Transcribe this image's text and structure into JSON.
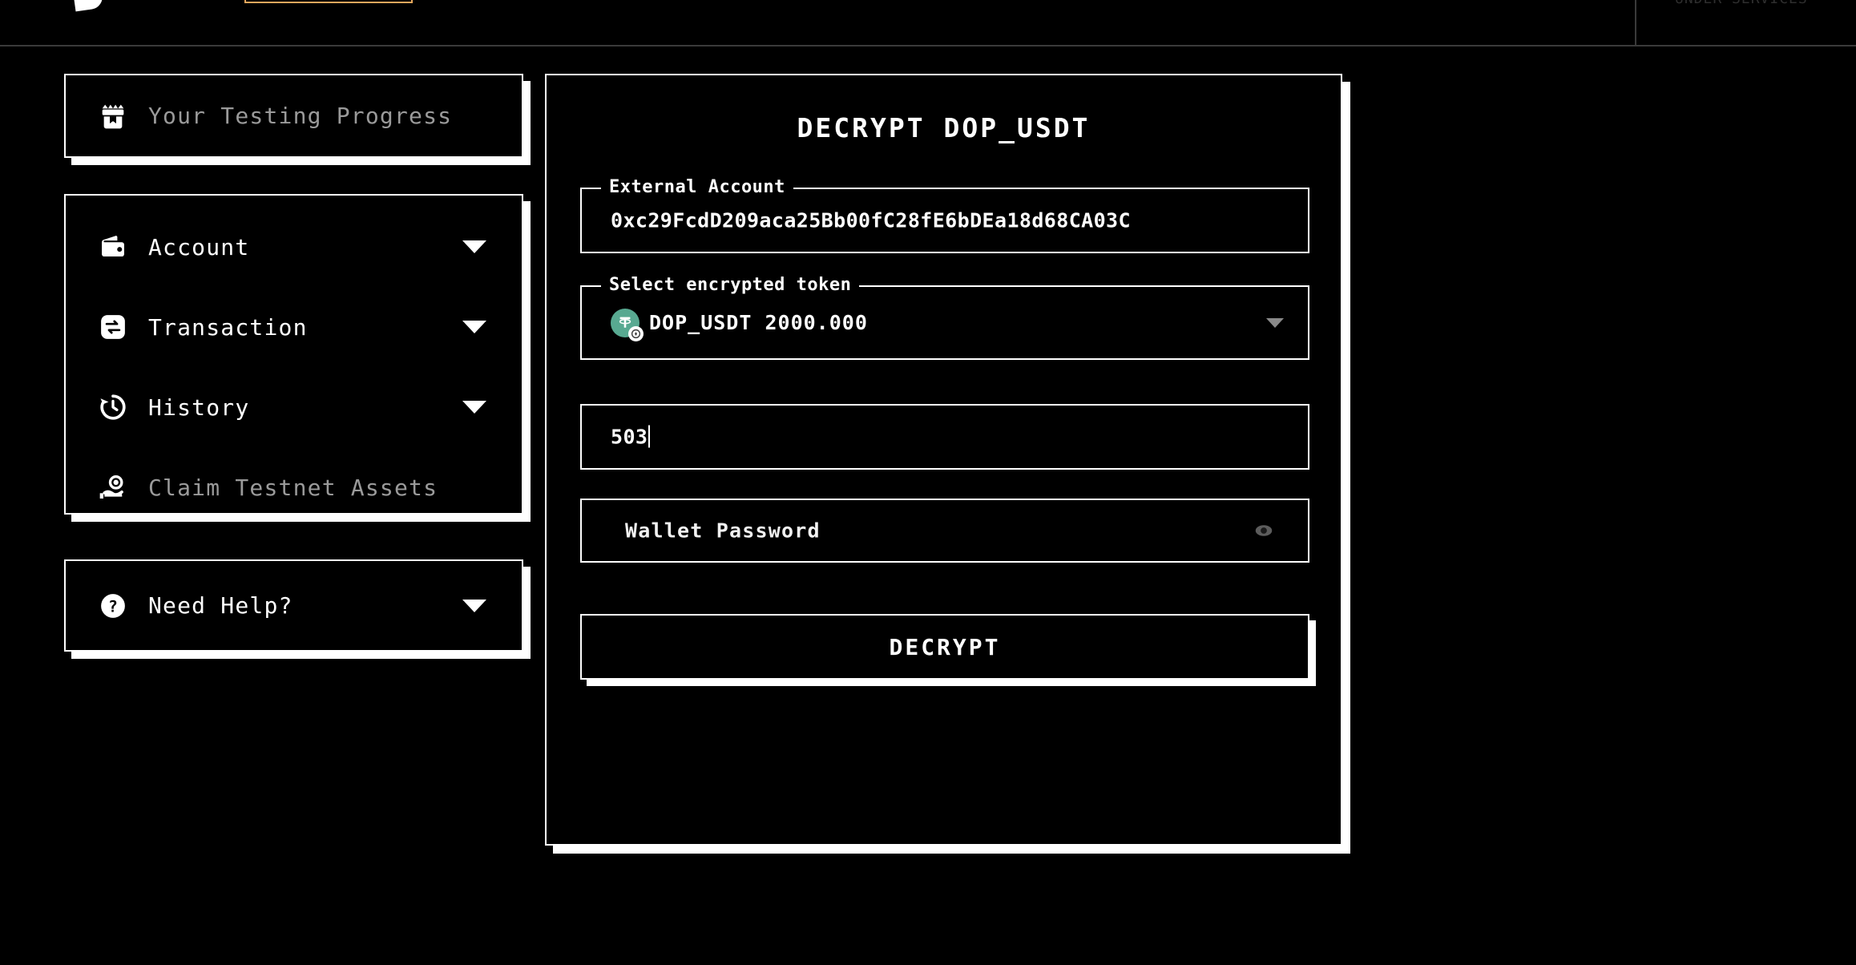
{
  "header": {
    "logo_icon": "brand-logo-icon",
    "active_tab_label": "",
    "right_text": "UNDER SERVICES",
    "accent_color": "#e8a75c"
  },
  "sidebar": {
    "progress_card": {
      "icon": "gift-box-icon",
      "label": "Your Testing Progress"
    },
    "menu_items": [
      {
        "icon": "wallet-icon",
        "label": "Account",
        "has_caret": true,
        "muted": false
      },
      {
        "icon": "swap-icon",
        "label": "Transaction",
        "has_caret": true,
        "muted": false
      },
      {
        "icon": "history-icon",
        "label": "History",
        "has_caret": true,
        "muted": false
      },
      {
        "icon": "hand-coin-icon",
        "label": "Claim Testnet Assets",
        "has_caret": false,
        "muted": true
      }
    ],
    "help_card": {
      "icon": "question-circle-icon",
      "label": "Need Help?",
      "has_caret": true
    }
  },
  "main": {
    "title": "DECRYPT DOP_USDT",
    "external_account": {
      "legend": "External Account",
      "value": "0xc29FcdD209aca25Bb00fC28fE6bDEa18d68CA03C"
    },
    "token_select": {
      "legend": "Select encrypted token",
      "token_symbol": "DOP_USDT",
      "token_amount": "2000.000",
      "display": "DOP_USDT 2000.000",
      "logo_color": "#58a991",
      "logo_glyph": "T",
      "caret_icon": "chevron-down-icon"
    },
    "amount_input": {
      "value": "503",
      "placeholder": ""
    },
    "password_input": {
      "value": "",
      "placeholder": "Wallet Password",
      "toggle_icon": "eye-icon"
    },
    "submit_button": {
      "label": "DECRYPT"
    }
  }
}
